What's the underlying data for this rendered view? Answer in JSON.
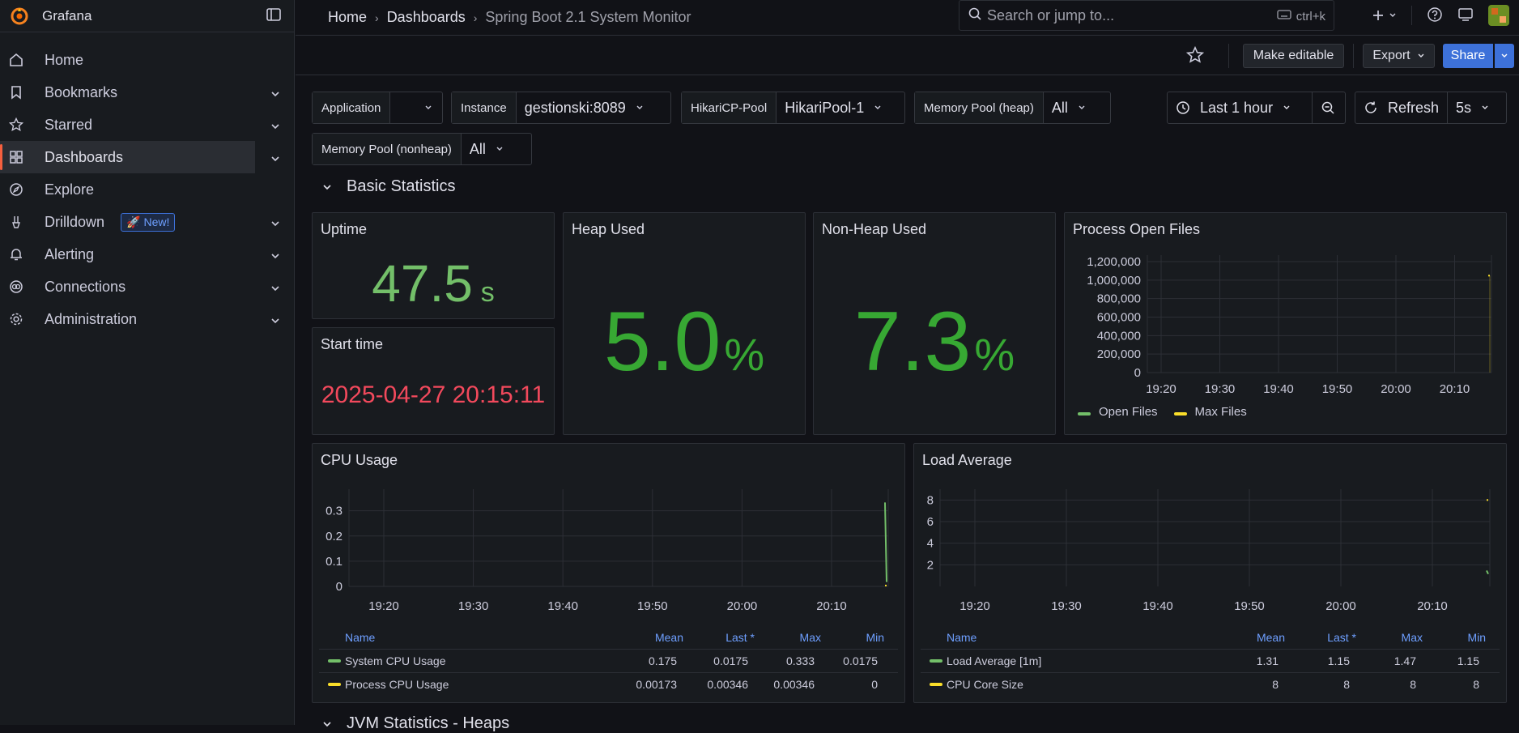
{
  "app": {
    "name": "Grafana"
  },
  "sidebar": {
    "items": [
      {
        "label": "Home",
        "icon": "home-icon"
      },
      {
        "label": "Bookmarks",
        "icon": "bookmark-icon"
      },
      {
        "label": "Starred",
        "icon": "star-icon"
      },
      {
        "label": "Dashboards",
        "icon": "dashboards-icon"
      },
      {
        "label": "Explore",
        "icon": "compass-icon"
      },
      {
        "label": "Drilldown",
        "icon": "drilldown-icon",
        "badge": "New!"
      },
      {
        "label": "Alerting",
        "icon": "bell-icon"
      },
      {
        "label": "Connections",
        "icon": "connections-icon"
      },
      {
        "label": "Administration",
        "icon": "gear-icon"
      }
    ]
  },
  "breadcrumb": {
    "home": "Home",
    "dashboards": "Dashboards",
    "current": "Spring Boot 2.1 System Monitor"
  },
  "search": {
    "placeholder": "Search or jump to...",
    "shortcut": "ctrl+k"
  },
  "toolbar": {
    "make_editable": "Make editable",
    "export": "Export",
    "share": "Share"
  },
  "variables": {
    "application": {
      "label": "Application",
      "value": ""
    },
    "instance": {
      "label": "Instance",
      "value": "gestionski:8089"
    },
    "hikari": {
      "label": "HikariCP-Pool",
      "value": "HikariPool-1"
    },
    "heap": {
      "label": "Memory Pool (heap)",
      "value": "All"
    },
    "nonheap": {
      "label": "Memory Pool (nonheap)",
      "value": "All"
    }
  },
  "time": {
    "range": "Last 1 hour",
    "refresh": "Refresh",
    "interval": "5s"
  },
  "row": {
    "title": "Basic Statistics",
    "next_title": "JVM Statistics - Heaps"
  },
  "panels": {
    "uptime": {
      "title": "Uptime",
      "value": "47.5",
      "unit": "s"
    },
    "start_time": {
      "title": "Start time",
      "value": "2025-04-27 20:15:11"
    },
    "heap_used": {
      "title": "Heap Used",
      "value": "5.0",
      "unit": "%"
    },
    "non_heap_used": {
      "title": "Non-Heap Used",
      "value": "7.3",
      "unit": "%"
    },
    "open_files": {
      "title": "Process Open Files",
      "legend": [
        "Open Files",
        "Max Files"
      ]
    },
    "cpu": {
      "title": "CPU Usage",
      "columns": [
        "Name",
        "Mean",
        "Last *",
        "Max",
        "Min"
      ],
      "rows": [
        {
          "name": "System CPU Usage",
          "mean": "0.175",
          "last": "0.0175",
          "max": "0.333",
          "min": "0.0175",
          "color": "#73bf69"
        },
        {
          "name": "Process CPU Usage",
          "mean": "0.00173",
          "last": "0.00346",
          "max": "0.00346",
          "min": "0",
          "color": "#fade2a"
        }
      ]
    },
    "load": {
      "title": "Load Average",
      "columns": [
        "Name",
        "Mean",
        "Last *",
        "Max",
        "Min"
      ],
      "rows": [
        {
          "name": "Load Average [1m]",
          "mean": "1.31",
          "last": "1.15",
          "max": "1.47",
          "min": "1.15",
          "color": "#73bf69"
        },
        {
          "name": "CPU Core Size",
          "mean": "8",
          "last": "8",
          "max": "8",
          "min": "8",
          "color": "#fade2a"
        }
      ]
    }
  },
  "chart_data": [
    {
      "type": "line",
      "title": "Process Open Files",
      "x": [
        "19:20",
        "19:30",
        "19:40",
        "19:50",
        "20:00",
        "20:10"
      ],
      "yticks": [
        "0",
        "200,000",
        "400,000",
        "600,000",
        "800,000",
        "1,000,000",
        "1,200,000"
      ],
      "ylim": [
        0,
        1200000
      ],
      "series": [
        {
          "name": "Open Files",
          "color": "#73bf69",
          "values": [
            null,
            null,
            null,
            null,
            null,
            null
          ]
        },
        {
          "name": "Max Files",
          "color": "#fade2a",
          "values": [
            null,
            null,
            null,
            null,
            null,
            1048576
          ]
        }
      ]
    },
    {
      "type": "line",
      "title": "CPU Usage",
      "x": [
        "19:20",
        "19:30",
        "19:40",
        "19:50",
        "20:00",
        "20:10"
      ],
      "yticks": [
        "0",
        "0.1",
        "0.2",
        "0.3"
      ],
      "ylim": [
        0,
        0.36
      ],
      "series": [
        {
          "name": "System CPU Usage",
          "color": "#73bf69",
          "points": [
            [
              0.333
            ],
            [
              0.0175
            ]
          ]
        },
        {
          "name": "Process CPU Usage",
          "color": "#fade2a",
          "points": [
            [
              0.00346
            ],
            [
              0.00346
            ]
          ]
        }
      ]
    },
    {
      "type": "line",
      "title": "Load Average",
      "x": [
        "19:20",
        "19:30",
        "19:40",
        "19:50",
        "20:00",
        "20:10"
      ],
      "yticks": [
        "2",
        "4",
        "6",
        "8"
      ],
      "ylim": [
        0,
        8.4
      ],
      "series": [
        {
          "name": "Load Average [1m]",
          "color": "#73bf69",
          "points": [
            [
              1.47
            ],
            [
              1.15
            ]
          ]
        },
        {
          "name": "CPU Core Size",
          "color": "#fade2a",
          "points": [
            [
              8
            ],
            [
              8
            ]
          ]
        }
      ]
    }
  ]
}
